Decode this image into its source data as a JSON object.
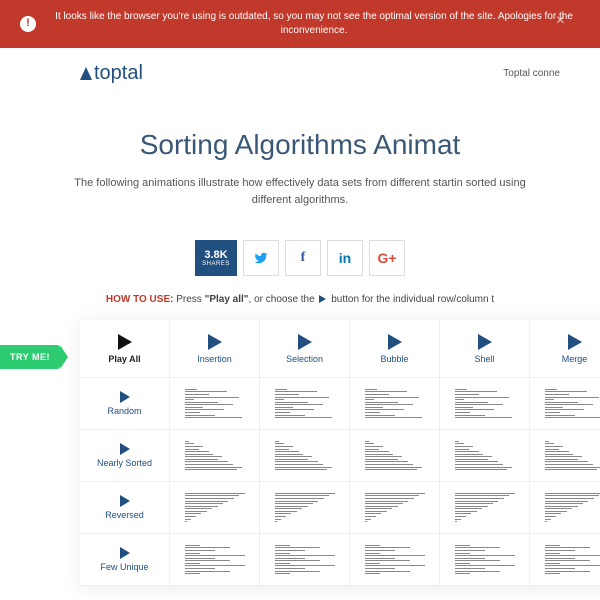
{
  "alert": {
    "message": "It looks like the browser you're using is outdated, so you may not see the optimal version of the site. Apologies for the inconvenience.",
    "close": "×"
  },
  "brand": {
    "name": "toptal",
    "tagline": "Toptal conne"
  },
  "hero": {
    "title": "Sorting Algorithms Animat",
    "subtitle": "The following animations illustrate how effectively data sets from different startin\nsorted using different algorithms."
  },
  "shares": {
    "count": "3.8K",
    "label": "SHARES"
  },
  "howto": {
    "prefix": "HOW TO USE:",
    "body_1": " Press ",
    "bold": "\"Play all\"",
    "body_2": ", or choose the ",
    "body_3": " button for the individual row/column t"
  },
  "try_me": "TRY ME!",
  "grid": {
    "play_all": "Play All",
    "algorithms": [
      "Insertion",
      "Selection",
      "Bubble",
      "Shell",
      "Merge"
    ],
    "rows": [
      "Random",
      "Nearly Sorted",
      "Reversed",
      "Few Unique"
    ]
  }
}
